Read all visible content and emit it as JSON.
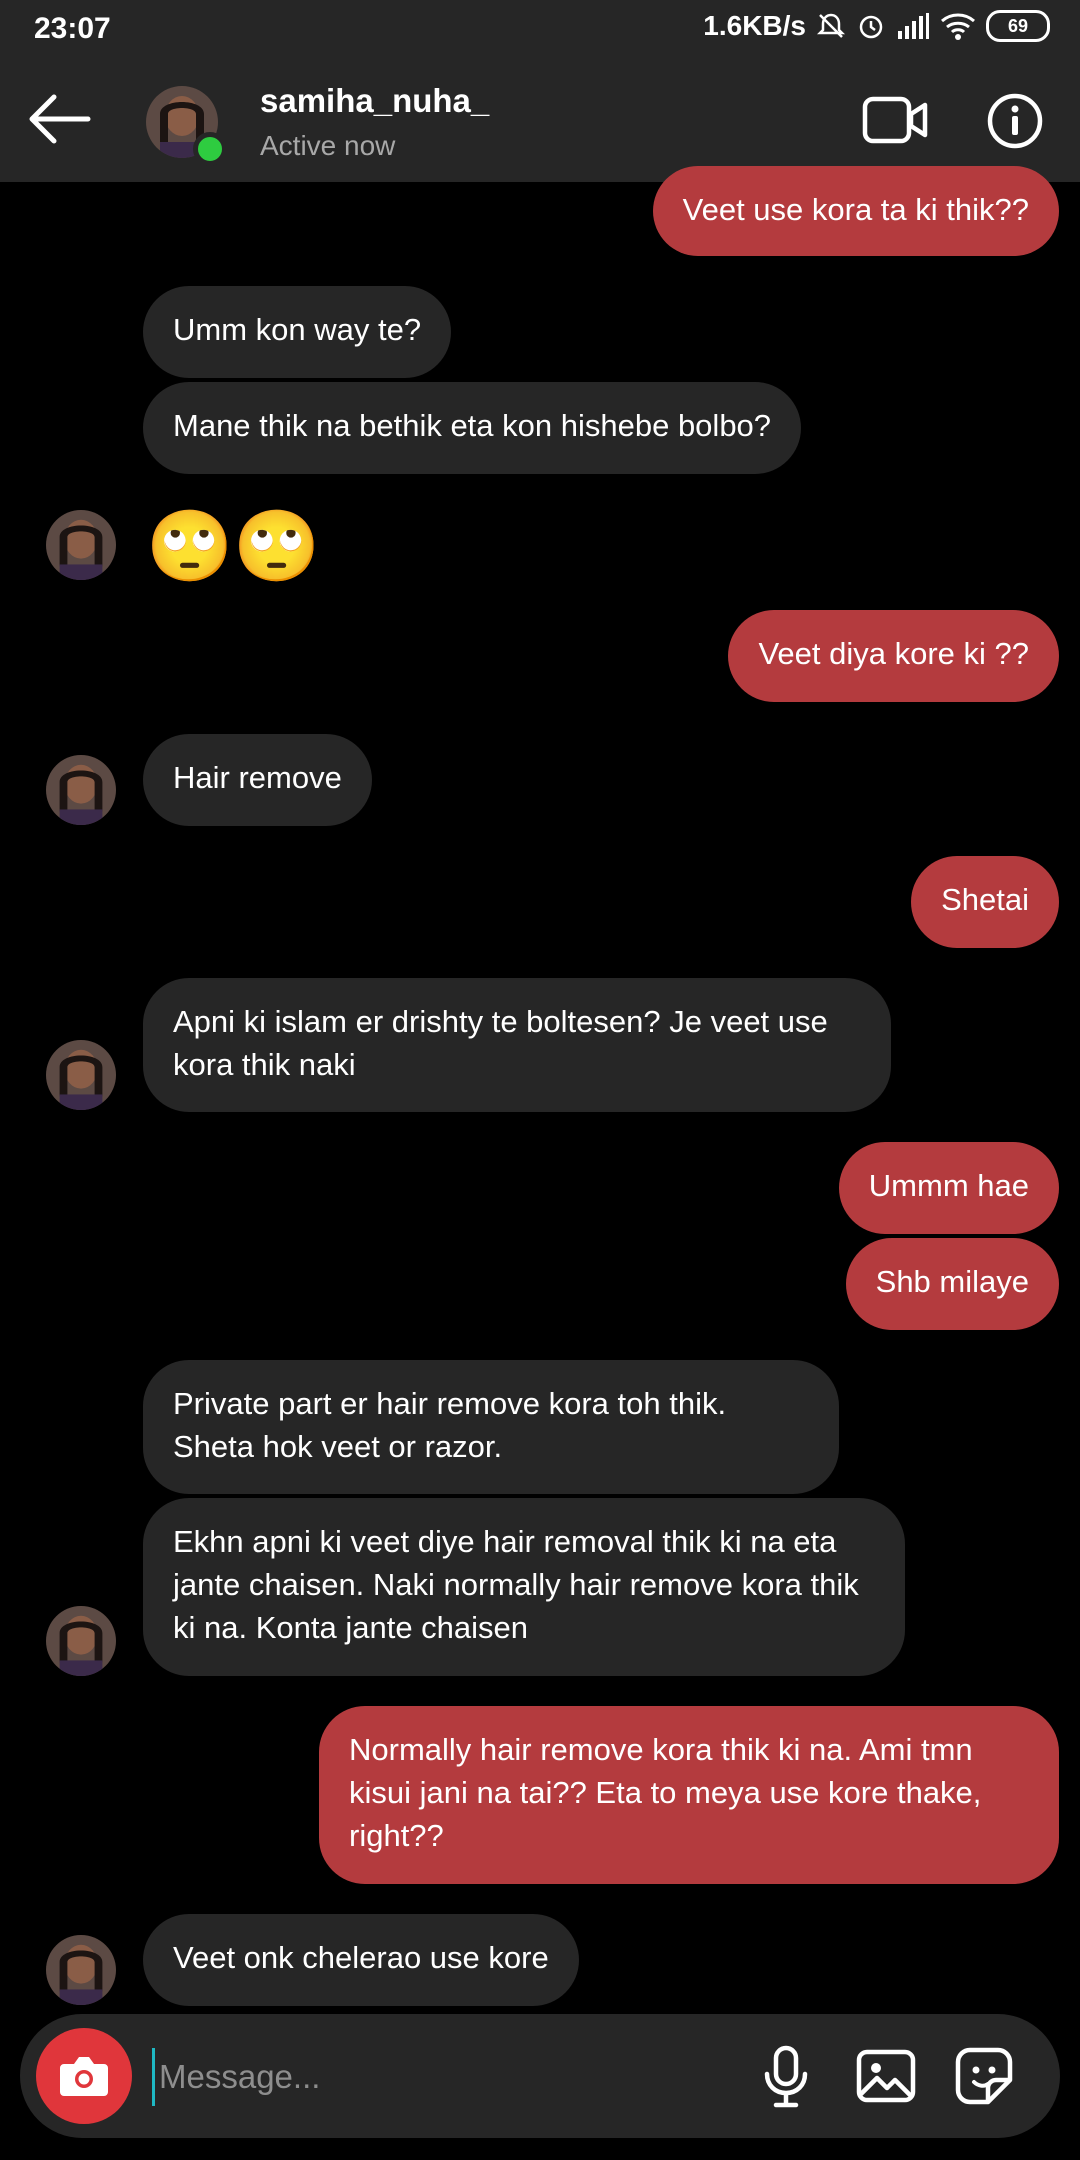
{
  "status_bar": {
    "time": "23:07",
    "net_speed": "1.6KB/s",
    "battery": "69"
  },
  "header": {
    "username": "samiha_nuha_",
    "status": "Active now"
  },
  "messages": [
    {
      "from": "me",
      "text": "Veet use kora ta ki thik??"
    },
    {
      "from": "them",
      "text": "Umm kon way te?"
    },
    {
      "from": "them",
      "text": "Mane thik na bethik eta kon hishebe bolbo?"
    },
    {
      "from": "them",
      "text": "🙄🙄"
    },
    {
      "from": "me",
      "text": "Veet diya kore ki ??"
    },
    {
      "from": "them",
      "text": "Hair remove"
    },
    {
      "from": "me",
      "text": "Shetai"
    },
    {
      "from": "them",
      "text": "Apni ki islam er drishty te boltesen? Je veet use kora thik naki"
    },
    {
      "from": "me",
      "text": "Ummm hae"
    },
    {
      "from": "me",
      "text": "Shb milaye"
    },
    {
      "from": "them",
      "text": "Private part er hair remove kora toh thik. Sheta hok veet or razor."
    },
    {
      "from": "them",
      "text": "Ekhn apni ki veet diye hair removal thik ki na eta jante chaisen. Naki normally hair remove kora thik ki na. Konta jante chaisen"
    },
    {
      "from": "me",
      "text": "Normally hair remove kora thik ki na. Ami tmn kisui jani na tai?? Eta to meya use kore thake, right??"
    },
    {
      "from": "them",
      "text": "Veet onk chelerao use kore"
    }
  ],
  "composer": {
    "placeholder": "Message..."
  },
  "icons": {
    "back": "arrow-left-icon",
    "video": "video-camera-icon",
    "info": "info-icon",
    "camera": "camera-icon",
    "mic": "microphone-icon",
    "gallery": "image-icon",
    "sticker": "sticker-icon"
  },
  "colors": {
    "outgoing_bubble": "#b43b3e",
    "incoming_bubble": "#262626",
    "background": "#000000",
    "camera_button": "#e0363b",
    "active_dot": "#2ecc40"
  }
}
